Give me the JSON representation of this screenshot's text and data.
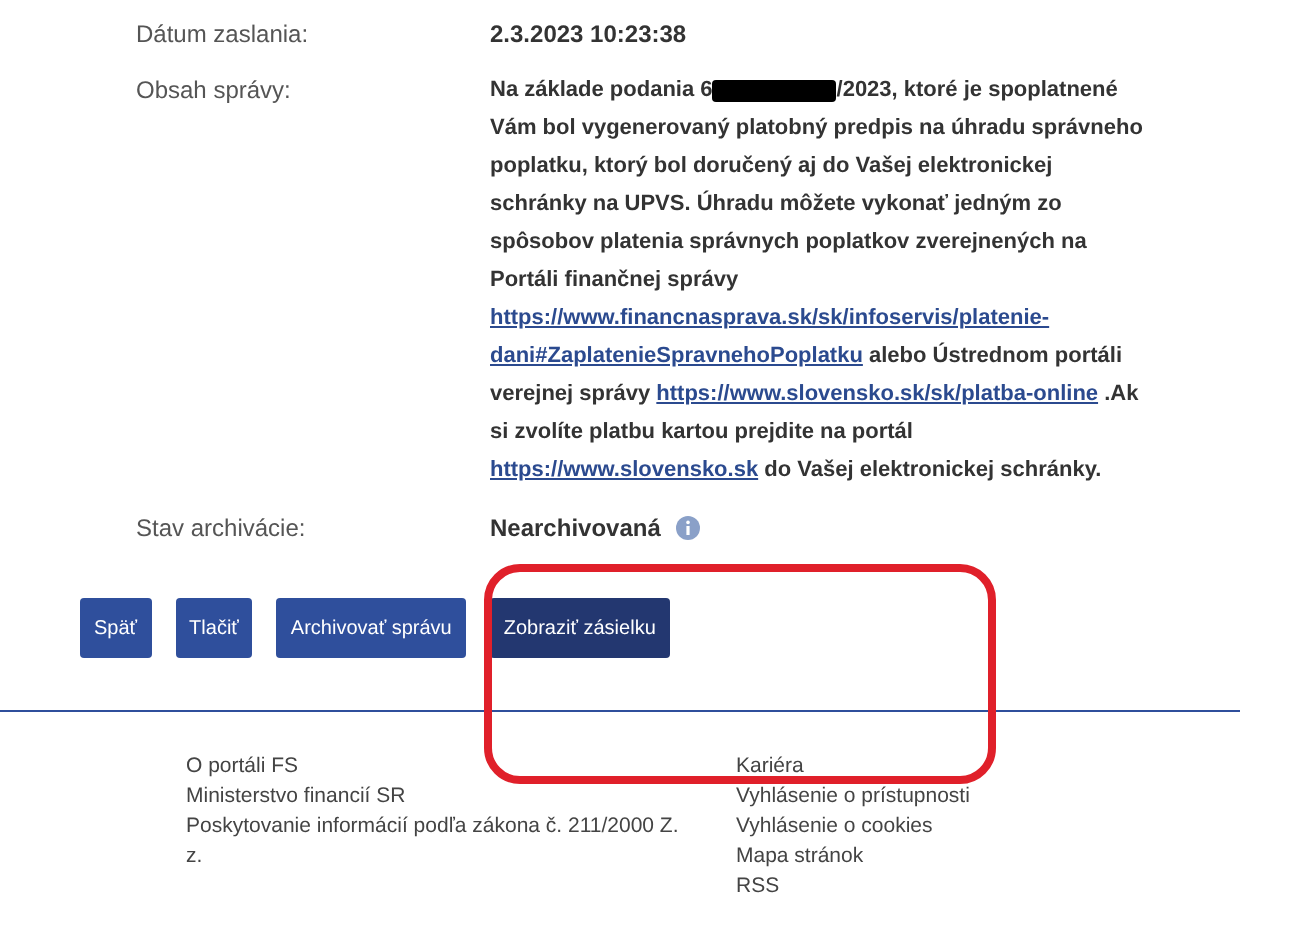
{
  "fields": [
    {
      "label": "Dátum zaslania:",
      "kind": "plain",
      "value": "2.3.2023 10:23:38"
    },
    {
      "label": "Obsah správy:",
      "kind": "message",
      "segments": [
        {
          "kind": "text",
          "text": "Na základe podania 6"
        },
        {
          "kind": "redaction"
        },
        {
          "kind": "text",
          "text": "/2023, ktoré je spoplatnené Vám bol vygenerovaný platobný predpis na úhradu správneho poplatku, ktorý bol doručený aj do Vašej elektronickej schránky na UPVS. Úhradu môžete vykonať jedným zo spôsobov platenia správnych poplatkov zverejnených na Portáli finančnej správy "
        },
        {
          "kind": "link",
          "text": "https://www.financnasprava.sk/sk/infoservis/platenie-"
        },
        {
          "kind": "link",
          "text": "dani#ZaplatenieSpravnehoPoplatku"
        },
        {
          "kind": "text",
          "text": " alebo Ústrednom portáli verejnej správy "
        },
        {
          "kind": "link",
          "text": "https://www.slovensko.sk/sk/platba-online"
        },
        {
          "kind": "text",
          "text": " .Ak si zvolíte platbu kartou prejdite na portál "
        },
        {
          "kind": "link",
          "text": "https://www.slovensko.sk"
        },
        {
          "kind": "text",
          "text": " do Vašej elektronickej schránky."
        }
      ]
    },
    {
      "label": "Stav archivácie:",
      "kind": "status",
      "value": "Nearchivovaná"
    }
  ],
  "buttons": [
    {
      "label": "Späť",
      "selected": false
    },
    {
      "label": "Tlačiť",
      "selected": false
    },
    {
      "label": "Archivovať správu",
      "selected": false
    },
    {
      "label": "Zobraziť zásielku",
      "selected": true
    }
  ],
  "footer": {
    "column_1": [
      "O portáli FS",
      "Ministerstvo financií SR",
      "Poskytovanie informácií podľa zákona č. 211/2000 Z. z."
    ],
    "column_2": [
      "Kariéra",
      "Vyhlásenie o prístupnosti",
      "Vyhlásenie o cookies",
      "Mapa stránok",
      "RSS"
    ]
  }
}
